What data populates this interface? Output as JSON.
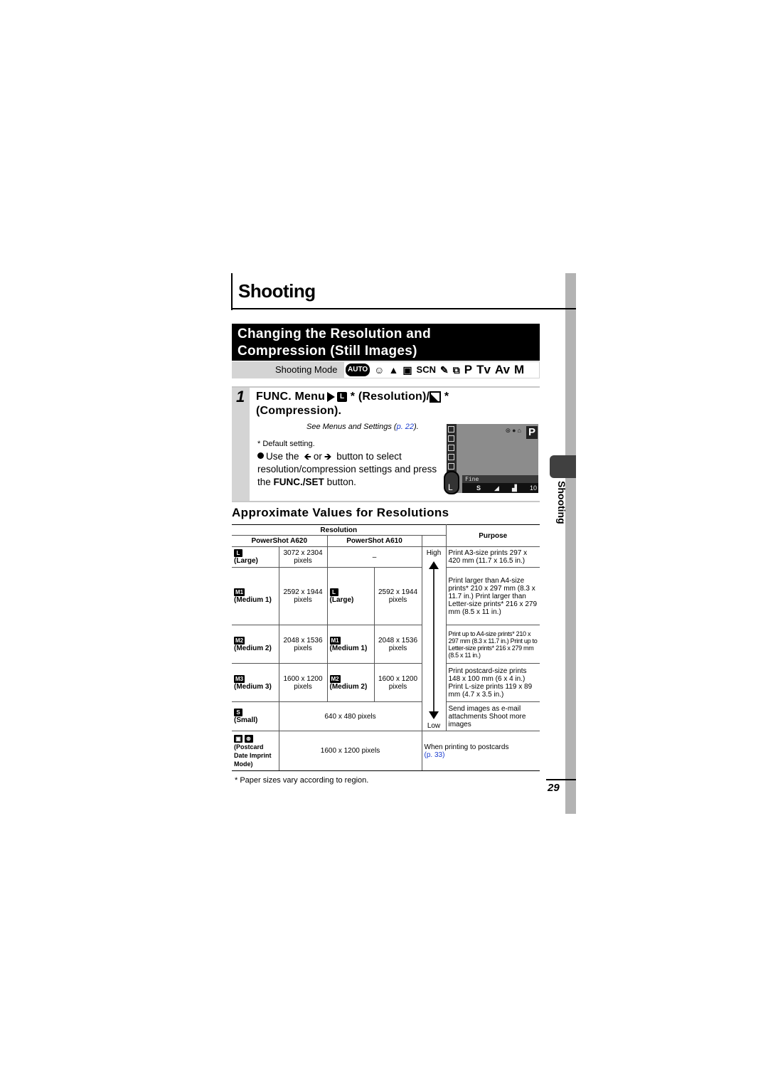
{
  "chapter": {
    "title": "Shooting"
  },
  "side_tab": {
    "label": "Shooting"
  },
  "section": {
    "title_line1": "Changing the Resolution and",
    "title_line2": "Compression (Still Images)",
    "shooting_mode_label": "Shooting Mode",
    "mode_icons": [
      {
        "name": "auto-mode-icon",
        "text": "AUTO"
      },
      {
        "name": "portrait-mode-icon",
        "text": "☺"
      },
      {
        "name": "landscape-mode-icon",
        "text": "▲"
      },
      {
        "name": "night-scene-mode-icon",
        "text": "▣"
      },
      {
        "name": "scn-mode-icon",
        "text": "SCN"
      },
      {
        "name": "stitch-assist-icon",
        "text": "✎"
      },
      {
        "name": "movie-mode-icon",
        "text": "⧉"
      },
      {
        "name": "p-mode-icon",
        "text": "P"
      },
      {
        "name": "tv-mode-icon",
        "text": "Tv"
      },
      {
        "name": "av-mode-icon",
        "text": "Av"
      },
      {
        "name": "m-mode-icon",
        "text": "M"
      }
    ]
  },
  "step": {
    "number": "1",
    "title_part1": "FUNC. Menu",
    "resolution_icon": "L",
    "title_part2": "* (Resolution)/",
    "title_part3": "*",
    "title_line2": "(Compression).",
    "see_menus_prefix": "See Menus and Settings (",
    "see_menus_link": "p. 22",
    "see_menus_suffix": ").",
    "default_note": "* Default setting.",
    "bullet_part1": "Use the",
    "left_arrow": "◆",
    "bullet_or": "or",
    "right_arrow": "◆",
    "bullet_part2": "button to select resolution/compression settings and press the",
    "bullet_bold": "FUNC./SET",
    "bullet_part3": "button."
  },
  "lcd": {
    "mode": "P",
    "status_icons": "⊛●⌂",
    "compression_label": "Fine",
    "selected_resolution": "L",
    "option_s": "S",
    "shots_remaining": "10"
  },
  "resolutions": {
    "heading": "Approximate Values for Resolutions",
    "header_resolution": "Resolution",
    "header_purpose": "Purpose",
    "header_a620": "PowerShot A620",
    "header_a610": "PowerShot A610",
    "high_label": "High",
    "low_label": "Low",
    "rows": [
      {
        "a620_icon": "L",
        "a620_name": "(Large)",
        "a620_size": "3072 x 2304",
        "a620_unit": "pixels",
        "a610_value": "–",
        "purpose": "Print A3-size prints 297 x 420 mm (11.7 x 16.5 in.)"
      },
      {
        "a620_icon": "M1",
        "a620_name": "(Medium 1)",
        "a620_size": "2592 x 1944",
        "a620_unit": "pixels",
        "a610_icon": "L",
        "a610_name": "(Large)",
        "a610_size": "2592 x 1944",
        "a610_unit": "pixels",
        "purpose": "Print larger than A4-size prints* 210 x 297 mm (8.3 x 11.7 in.) Print larger than Letter-size prints* 216 x 279 mm (8.5 x 11 in.)"
      },
      {
        "a620_icon": "M2",
        "a620_name": "(Medium 2)",
        "a620_size": "2048 x 1536",
        "a620_unit": "pixels",
        "a610_icon": "M1",
        "a610_name": "(Medium 1)",
        "a610_size": "2048 x 1536",
        "a610_unit": "pixels",
        "purpose": "Print up to A4-size prints* 210 x 297 mm (8.3 x 11.7 in.) Print up to Letter-size prints* 216 x 279 mm (8.5 x 11 in.)"
      },
      {
        "a620_icon": "M3",
        "a620_name": "(Medium 3)",
        "a620_size": "1600 x 1200",
        "a620_unit": "pixels",
        "a610_icon": "M2",
        "a610_name": "(Medium 2)",
        "a610_size": "1600 x 1200",
        "a610_unit": "pixels",
        "purpose": "Print postcard-size prints 148 x 100 mm (6 x 4 in.) Print L-size prints 119 x 89 mm (4.7 x 3.5 in.)"
      },
      {
        "a620_icon": "S",
        "a620_name": "(Small)",
        "shared_size": "640 x 480 pixels",
        "purpose": "Send images as e-mail attachments Shoot more images"
      },
      {
        "a620_name": "(Postcard Date Imprint Mode)",
        "shared_size": "1600 x 1200 pixels",
        "purpose": "When printing to postcards",
        "purpose_link": "(p. 33)"
      }
    ]
  },
  "footnote": "* Paper sizes vary according to region.",
  "page_number": "29",
  "colors": {
    "link": "#1a3ccf",
    "side_bar": "#b3b3b3",
    "side_tab": "#404040",
    "mode_bar": "#d4d4d4"
  }
}
